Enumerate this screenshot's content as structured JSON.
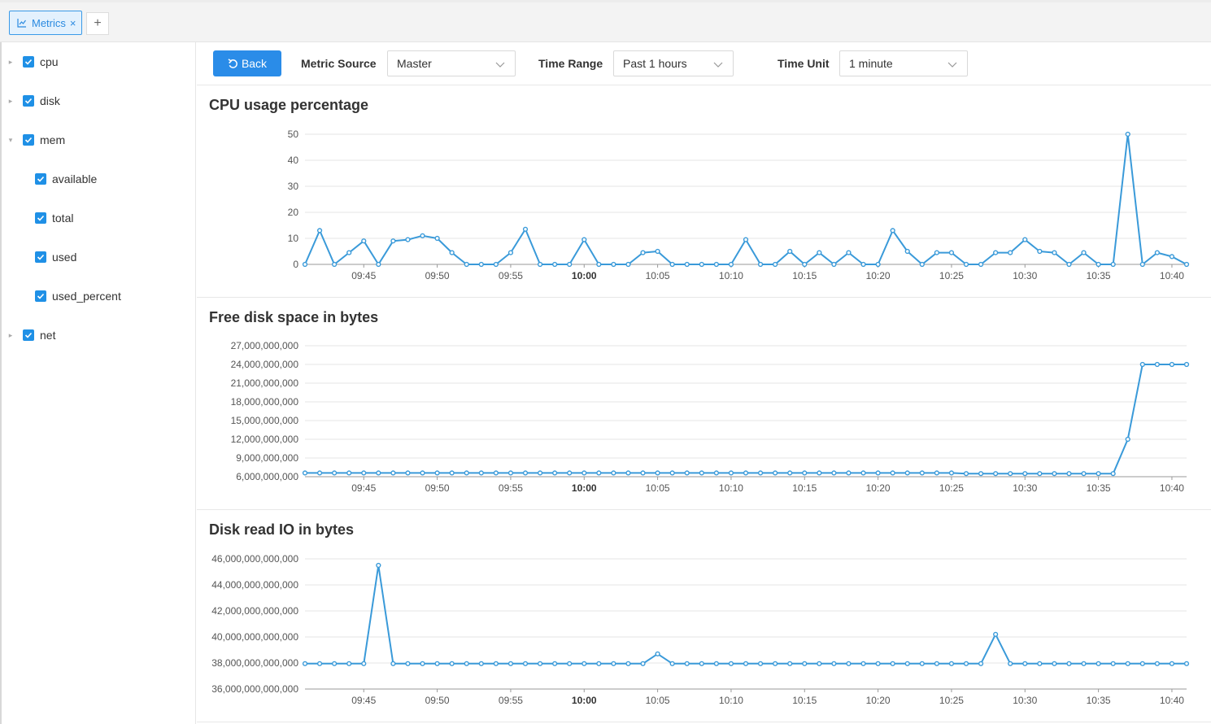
{
  "tabs": [
    {
      "label": "Metrics",
      "icon": "line-chart-icon"
    }
  ],
  "tab_add_label": "+",
  "tab_close_label": "×",
  "sidebar": {
    "items": [
      {
        "label": "cpu",
        "expanded": false,
        "checked": true,
        "level": 0
      },
      {
        "label": "disk",
        "expanded": false,
        "checked": true,
        "level": 0
      },
      {
        "label": "mem",
        "expanded": true,
        "checked": true,
        "level": 0
      },
      {
        "label": "available",
        "checked": true,
        "level": 1
      },
      {
        "label": "total",
        "checked": true,
        "level": 1
      },
      {
        "label": "used",
        "checked": true,
        "level": 1
      },
      {
        "label": "used_percent",
        "checked": true,
        "level": 1
      },
      {
        "label": "net",
        "expanded": false,
        "checked": true,
        "level": 0
      }
    ]
  },
  "toolbar": {
    "back_label": "Back",
    "metric_source_label": "Metric Source",
    "metric_source_value": "Master",
    "time_range_label": "Time Range",
    "time_range_value": "Past 1 hours",
    "time_unit_label": "Time Unit",
    "time_unit_value": "1 minute"
  },
  "colors": {
    "accent": "#2a8ce8",
    "series": "#3a9ad9",
    "grid": "#e6e6e6"
  },
  "chart_data": [
    {
      "type": "line",
      "title": "CPU usage percentage",
      "x_start": "09:41",
      "x_step_minutes": 1,
      "x_ticks": [
        "09:45",
        "09:50",
        "09:55",
        "10:00",
        "10:05",
        "10:10",
        "10:15",
        "10:20",
        "10:25",
        "10:30",
        "10:35",
        "10:40"
      ],
      "bold_tick": "10:00",
      "y_ticks": [
        "0",
        "10",
        "20",
        "30",
        "40",
        "50"
      ],
      "ylim": [
        0,
        50
      ],
      "values": [
        0,
        13,
        0,
        4.5,
        9,
        0,
        9,
        9.5,
        11,
        10,
        4.5,
        0,
        0,
        0,
        4.5,
        13.5,
        0,
        0,
        0,
        9.5,
        0,
        0,
        0,
        4.5,
        5,
        0,
        0,
        0,
        0,
        0,
        9.5,
        0,
        0,
        5,
        0,
        4.5,
        0,
        4.5,
        0,
        0,
        13,
        5,
        0,
        4.5,
        4.5,
        0,
        0,
        4.5,
        4.5,
        9.5,
        5,
        4.5,
        0,
        4.5,
        0,
        0,
        50,
        0,
        4.5,
        3,
        0
      ]
    },
    {
      "type": "line",
      "title": "Free disk space in bytes",
      "x_start": "09:41",
      "x_step_minutes": 1,
      "x_ticks": [
        "09:45",
        "09:50",
        "09:55",
        "10:00",
        "10:05",
        "10:10",
        "10:15",
        "10:20",
        "10:25",
        "10:30",
        "10:35",
        "10:40"
      ],
      "bold_tick": "10:00",
      "y_ticks": [
        "6,000,000,000",
        "9,000,000,000",
        "12,000,000,000",
        "15,000,000,000",
        "18,000,000,000",
        "21,000,000,000",
        "24,000,000,000",
        "27,000,000,000"
      ],
      "ylim": [
        6000000000,
        27000000000
      ],
      "values": [
        6600000000,
        6600000000,
        6600000000,
        6600000000,
        6600000000,
        6600000000,
        6600000000,
        6600000000,
        6600000000,
        6600000000,
        6600000000,
        6600000000,
        6600000000,
        6600000000,
        6600000000,
        6600000000,
        6600000000,
        6600000000,
        6600000000,
        6600000000,
        6600000000,
        6600000000,
        6600000000,
        6600000000,
        6600000000,
        6600000000,
        6600000000,
        6600000000,
        6600000000,
        6600000000,
        6600000000,
        6600000000,
        6600000000,
        6600000000,
        6600000000,
        6600000000,
        6600000000,
        6600000000,
        6600000000,
        6600000000,
        6600000000,
        6600000000,
        6600000000,
        6600000000,
        6600000000,
        6500000000,
        6500000000,
        6500000000,
        6500000000,
        6500000000,
        6500000000,
        6500000000,
        6500000000,
        6500000000,
        6500000000,
        6500000000,
        12000000000,
        24000000000,
        24000000000,
        24000000000,
        24000000000
      ]
    },
    {
      "type": "line",
      "title": "Disk read IO in bytes",
      "x_start": "09:41",
      "x_step_minutes": 1,
      "x_ticks": [
        "09:45",
        "09:50",
        "09:55",
        "10:00",
        "10:05",
        "10:10",
        "10:15",
        "10:20",
        "10:25",
        "10:30",
        "10:35",
        "10:40"
      ],
      "bold_tick": "10:00",
      "y_ticks": [
        "36,000,000,000,000",
        "38,000,000,000,000",
        "40,000,000,000,000",
        "42,000,000,000,000",
        "44,000,000,000,000",
        "46,000,000,000,000"
      ],
      "ylim": [
        36000000000000,
        46000000000000
      ],
      "values": [
        37950000000000,
        37950000000000,
        37950000000000,
        37950000000000,
        37950000000000,
        45500000000000,
        37950000000000,
        37950000000000,
        37950000000000,
        37950000000000,
        37950000000000,
        37950000000000,
        37950000000000,
        37950000000000,
        37950000000000,
        37950000000000,
        37950000000000,
        37950000000000,
        37950000000000,
        37950000000000,
        37950000000000,
        37950000000000,
        37950000000000,
        37950000000000,
        38700000000000,
        37950000000000,
        37950000000000,
        37950000000000,
        37950000000000,
        37950000000000,
        37950000000000,
        37950000000000,
        37950000000000,
        37950000000000,
        37950000000000,
        37950000000000,
        37950000000000,
        37950000000000,
        37950000000000,
        37950000000000,
        37950000000000,
        37950000000000,
        37950000000000,
        37950000000000,
        37950000000000,
        37950000000000,
        37950000000000,
        40200000000000,
        37950000000000,
        37950000000000,
        37950000000000,
        37950000000000,
        37950000000000,
        37950000000000,
        37950000000000,
        37950000000000,
        37950000000000,
        37950000000000,
        37950000000000,
        37950000000000,
        37950000000000
      ]
    }
  ]
}
